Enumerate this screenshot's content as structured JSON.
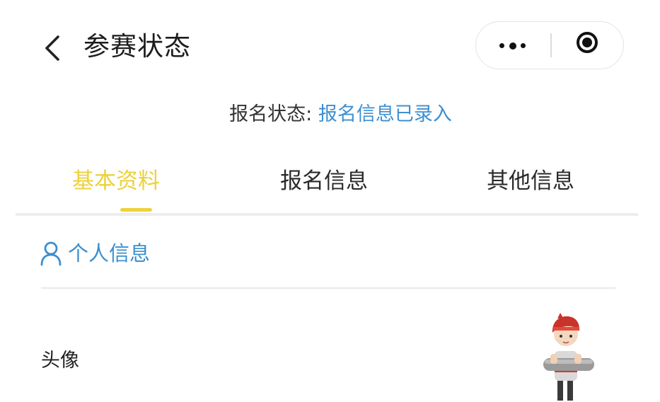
{
  "nav": {
    "title": "参赛状态"
  },
  "status": {
    "label": "报名状态: ",
    "value": "报名信息已录入"
  },
  "tabs": [
    {
      "label": "基本资料",
      "active": true
    },
    {
      "label": "报名信息",
      "active": false
    },
    {
      "label": "其他信息",
      "active": false
    }
  ],
  "section": {
    "title": "个人信息",
    "icon": "user-icon"
  },
  "fields": {
    "avatar_label": "头像"
  },
  "colors": {
    "accent_yellow": "#efd23b",
    "link_blue": "#3d8fd1"
  }
}
